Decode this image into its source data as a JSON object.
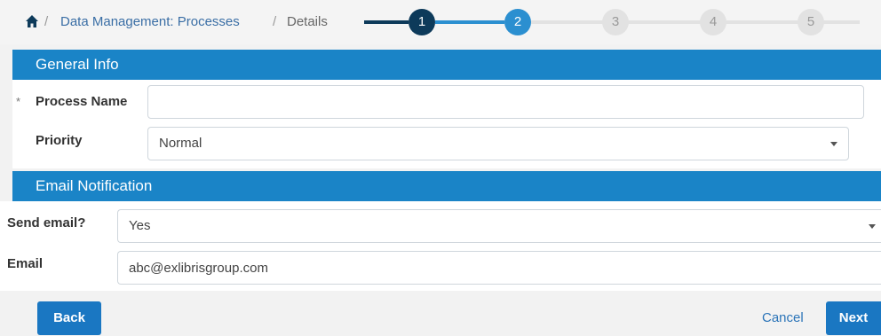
{
  "breadcrumb": {
    "link": "Data Management: Processes",
    "current": "Details",
    "separator": "/"
  },
  "stepper": {
    "steps": [
      "1",
      "2",
      "3",
      "4",
      "5"
    ],
    "current_step": 2,
    "colors": {
      "done": "#0d3a5a",
      "active": "#2b8fd0",
      "todo": "#e2e2e2"
    }
  },
  "general_info": {
    "title": "General Info",
    "required_mark": "*",
    "process_name_label": "Process Name",
    "process_name_value": "",
    "priority_label": "Priority",
    "priority_value": "Normal"
  },
  "email_notification": {
    "title": "Email Notification",
    "send_email_label": "Send email?",
    "send_email_value": "Yes",
    "email_label": "Email",
    "email_value": "abc@exlibrisgroup.com"
  },
  "footer": {
    "back_label": "Back",
    "cancel_label": "Cancel",
    "next_label": "Next"
  },
  "theme": {
    "header_blue": "#1a84c7",
    "button_blue": "#1a77c2",
    "link_blue": "#3a6ea5"
  },
  "icons": {
    "home": "home-icon",
    "dropdown": "caret-down-icon"
  }
}
